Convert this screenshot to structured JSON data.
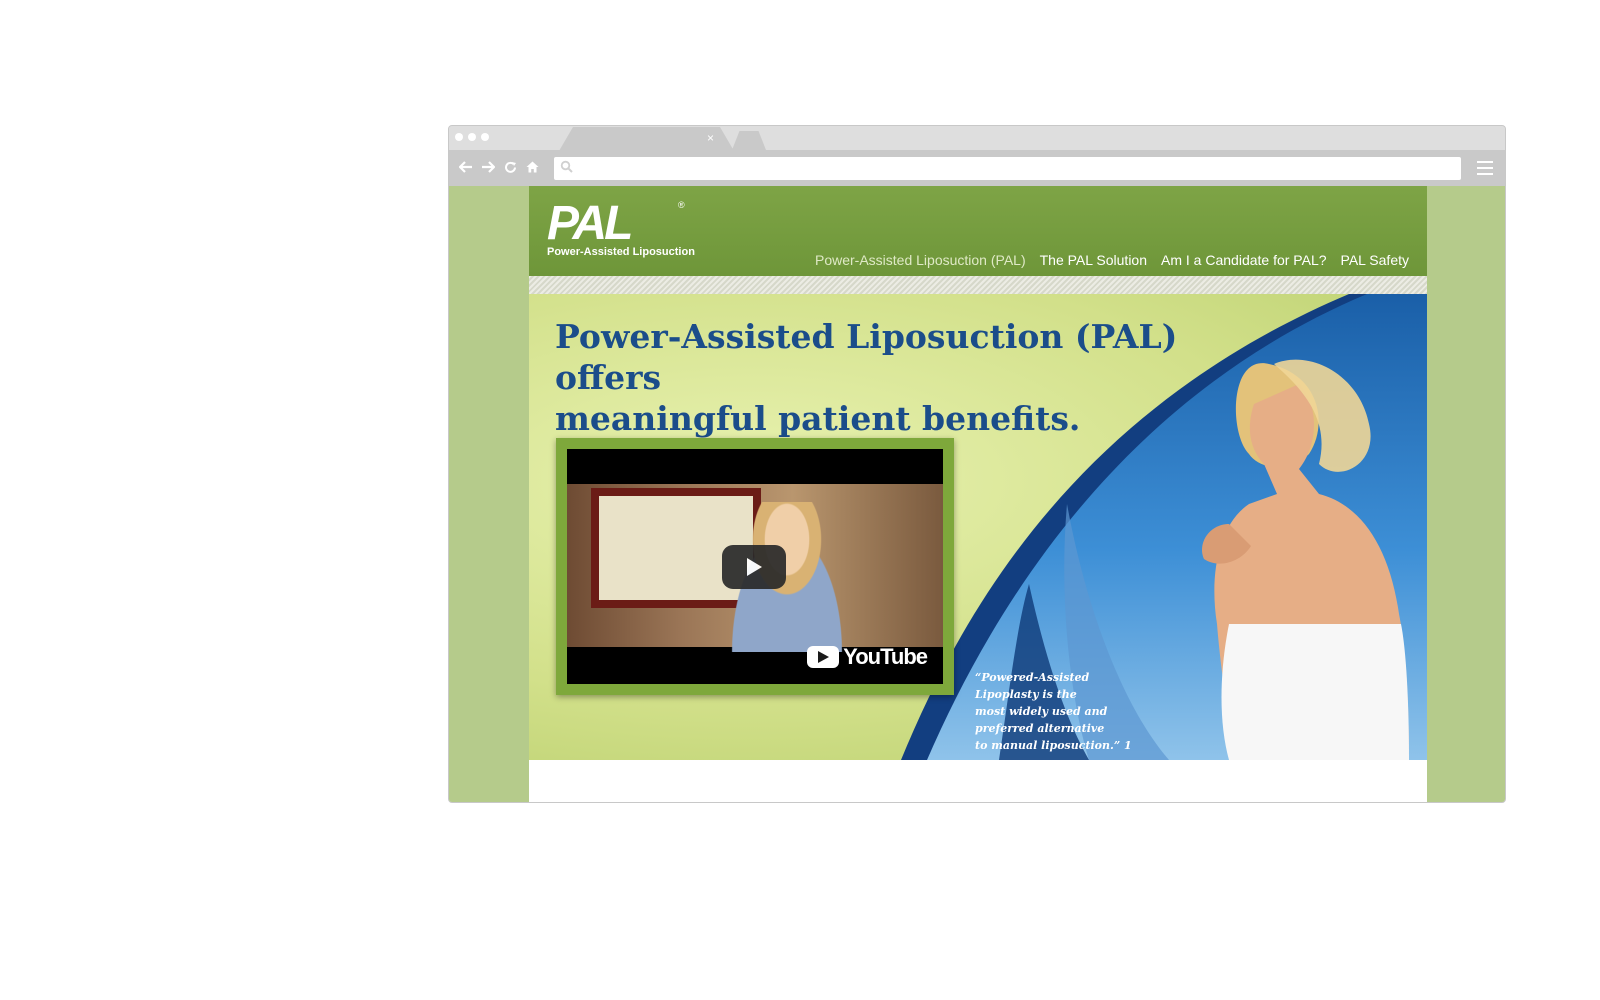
{
  "browser": {
    "tab_close": "×"
  },
  "site": {
    "logo": {
      "mark": "PAL",
      "registered": "®",
      "tagline": "Power-Assisted Liposuction"
    },
    "nav": [
      {
        "label": "Power-Assisted Liposuction (PAL)",
        "active": true
      },
      {
        "label": "The PAL Solution"
      },
      {
        "label": "Am I a Candidate for PAL?"
      },
      {
        "label": "PAL Safety"
      }
    ],
    "hero": {
      "headline_line1": "Power-Assisted Liposuction (PAL) offers",
      "headline_line2": "meaningful patient benefits.",
      "quote_line1": "“Powered-Assisted",
      "quote_line2": "Lipoplasty is the",
      "quote_line3": "most widely used and",
      "quote_line4": "preferred alternative",
      "quote_line5": "to manual liposuction.” 1"
    },
    "video": {
      "brand": "YouTube"
    }
  },
  "colors": {
    "header_green": "#7ea446",
    "headline_blue": "#1b4d8a",
    "sky_blue": "#1e6fb8",
    "page_bg_green": "#b5cb8b"
  }
}
